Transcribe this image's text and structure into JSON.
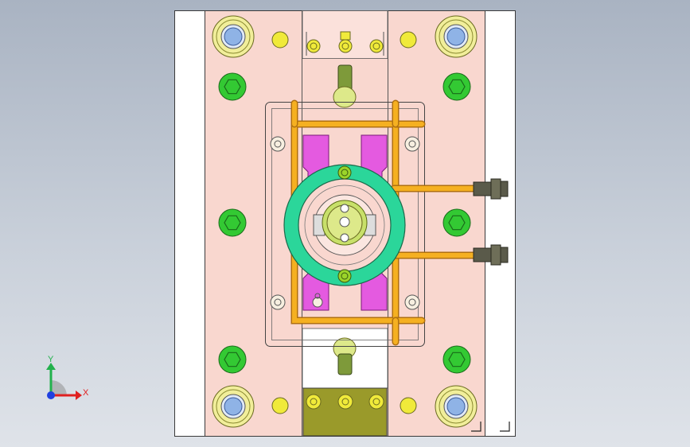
{
  "viewport": {
    "background_top": "#a9b3c2",
    "background_bottom": "#dfe3e9"
  },
  "colors": {
    "plate_white": "#ffffff",
    "plate_pink": "#f9d7cf",
    "plate_outline": "#3a3a3a",
    "bushing_outer": "#f1ee9a",
    "bushing_inner": "#8fb3e6",
    "hex_green": "#33c933",
    "bolt_yellow": "#f0ea3a",
    "cooling_orange": "#f5b021",
    "slide_magenta": "#e45ae0",
    "ring_teal": "#2bd69a",
    "sprue_olive": "#9a9a2a",
    "fitting_gray": "#5a5a4a"
  },
  "triad": {
    "y_label": "Y",
    "x_label": "X",
    "y_color": "#22b14c",
    "x_color": "#e02020",
    "z_color": "#2040e0"
  },
  "corner_marks": {
    "icon": "orientation-corner-icon"
  }
}
